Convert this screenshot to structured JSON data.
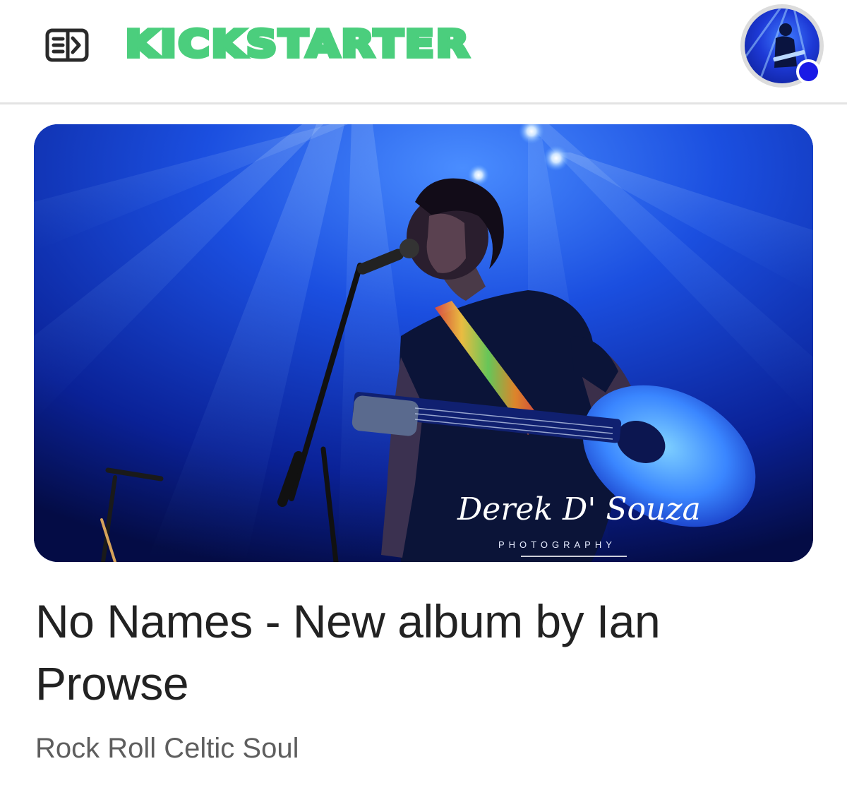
{
  "header": {
    "brand": "KICKSTARTER",
    "brand_color": "#4bce7d",
    "menu_icon": "sidebar-toggle-icon",
    "avatar_status_color": "#1a1ae6"
  },
  "project": {
    "title": "No Names - New album by Ian Prowse",
    "subtitle": "Rock Roll Celtic Soul",
    "image_signature": "Derek D' Souza",
    "image_signature_caption": "PHOTOGRAPHY"
  }
}
